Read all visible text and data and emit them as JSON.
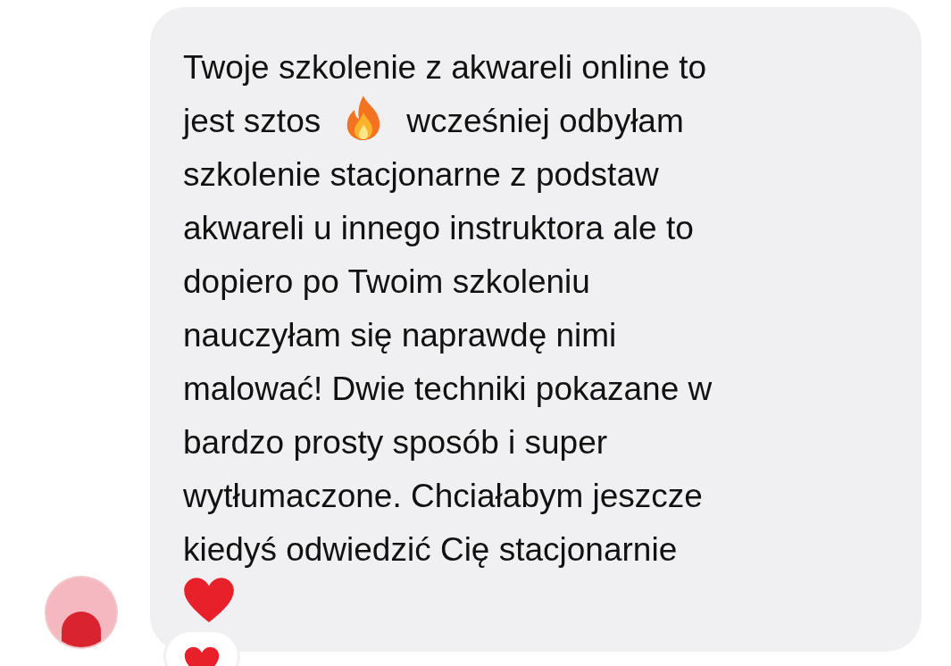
{
  "message": {
    "lines": [
      [
        {
          "kind": "text",
          "text": "Twoje szkolenie z akwareli online to"
        }
      ],
      [
        {
          "kind": "text",
          "text": "jest sztos"
        },
        {
          "kind": "fire"
        },
        {
          "kind": "text",
          "text": "wcześniej odbyłam"
        }
      ],
      [
        {
          "kind": "text",
          "text": "szkolenie stacjonarne z podstaw"
        }
      ],
      [
        {
          "kind": "text",
          "text": "akwareli u innego instruktora ale to"
        }
      ],
      [
        {
          "kind": "text",
          "text": "dopiero po Twoim szkoleniu"
        }
      ],
      [
        {
          "kind": "text",
          "text": "nauczyłam się naprawdę nimi"
        }
      ],
      [
        {
          "kind": "text",
          "text": "malować! Dwie techniki pokazane w"
        }
      ],
      [
        {
          "kind": "text",
          "text": "bardzo prosty sposób i super"
        }
      ],
      [
        {
          "kind": "text",
          "text": "wytłumaczone. Chciałabym jeszcze"
        }
      ],
      [
        {
          "kind": "text",
          "text": "kiedyś odwiedzić Cię stacjonarnie"
        }
      ],
      [
        {
          "kind": "heart"
        }
      ]
    ],
    "reaction": {
      "kind": "heart"
    }
  }
}
